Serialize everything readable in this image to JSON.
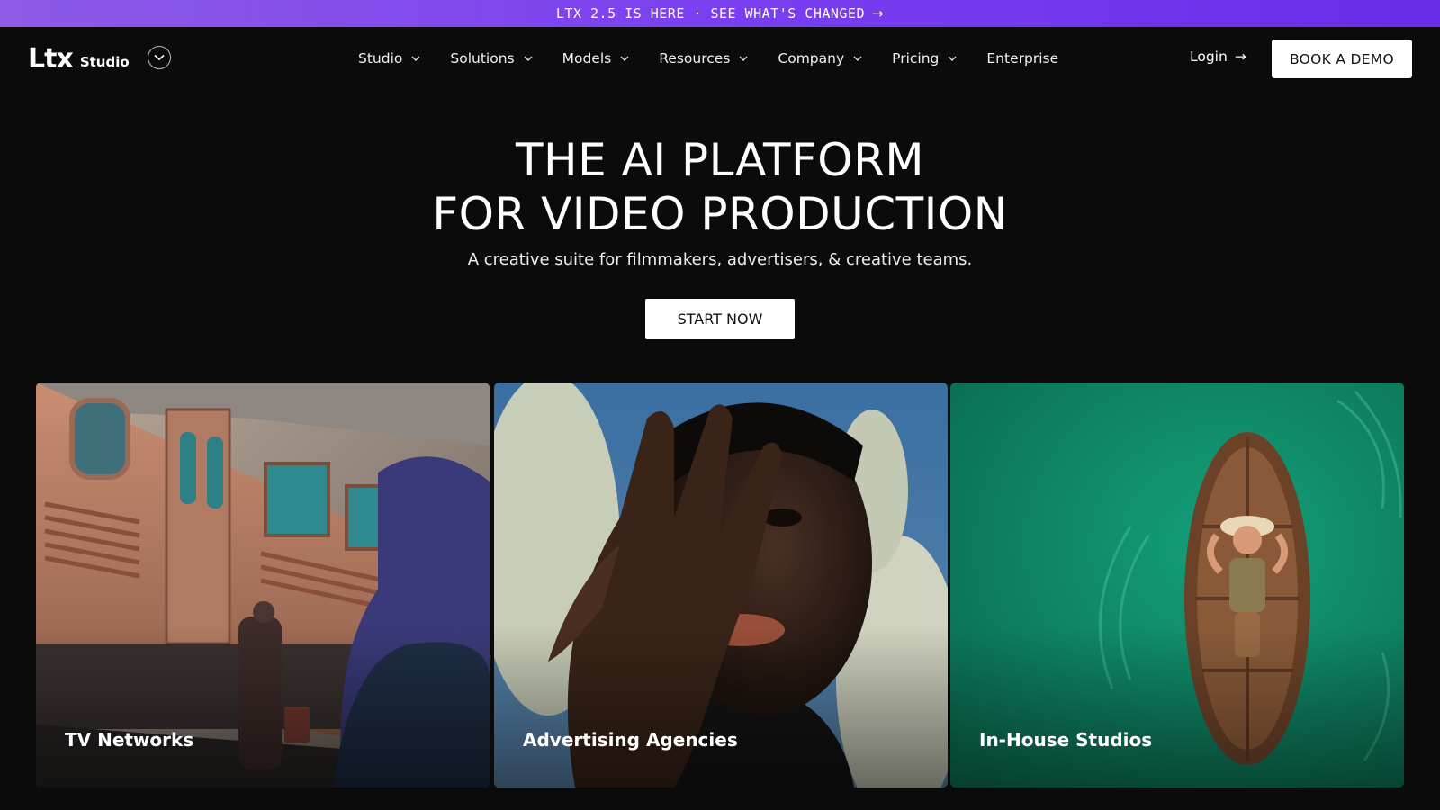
{
  "announcement": {
    "text": "LTX 2.5 IS HERE · SEE WHAT'S CHANGED",
    "arrow_icon": "arrow-right-icon"
  },
  "brand": {
    "mark": "Ltx",
    "sub": "Studio"
  },
  "nav": {
    "items": [
      {
        "label": "Studio",
        "has_dropdown": true
      },
      {
        "label": "Solutions",
        "has_dropdown": true
      },
      {
        "label": "Models",
        "has_dropdown": true
      },
      {
        "label": "Resources",
        "has_dropdown": true
      },
      {
        "label": "Company",
        "has_dropdown": true
      },
      {
        "label": "Pricing",
        "has_dropdown": true
      },
      {
        "label": "Enterprise",
        "has_dropdown": false
      }
    ],
    "login": "Login",
    "demo": "BOOK A DEMO"
  },
  "hero": {
    "title_line1": "THE AI PLATFORM",
    "title_line2": "FOR VIDEO PRODUCTION",
    "subtitle": "A creative suite for filmmakers, advertisers, & creative teams.",
    "cta": "START NOW"
  },
  "cards": [
    {
      "label": "TV Networks"
    },
    {
      "label": "Advertising Agencies"
    },
    {
      "label": "In-House Studios"
    }
  ],
  "colors": {
    "banner_start": "#8e5be6",
    "banner_end": "#6a2de8",
    "background": "#0b0b0b",
    "card3_green": "#0f8f6a"
  }
}
